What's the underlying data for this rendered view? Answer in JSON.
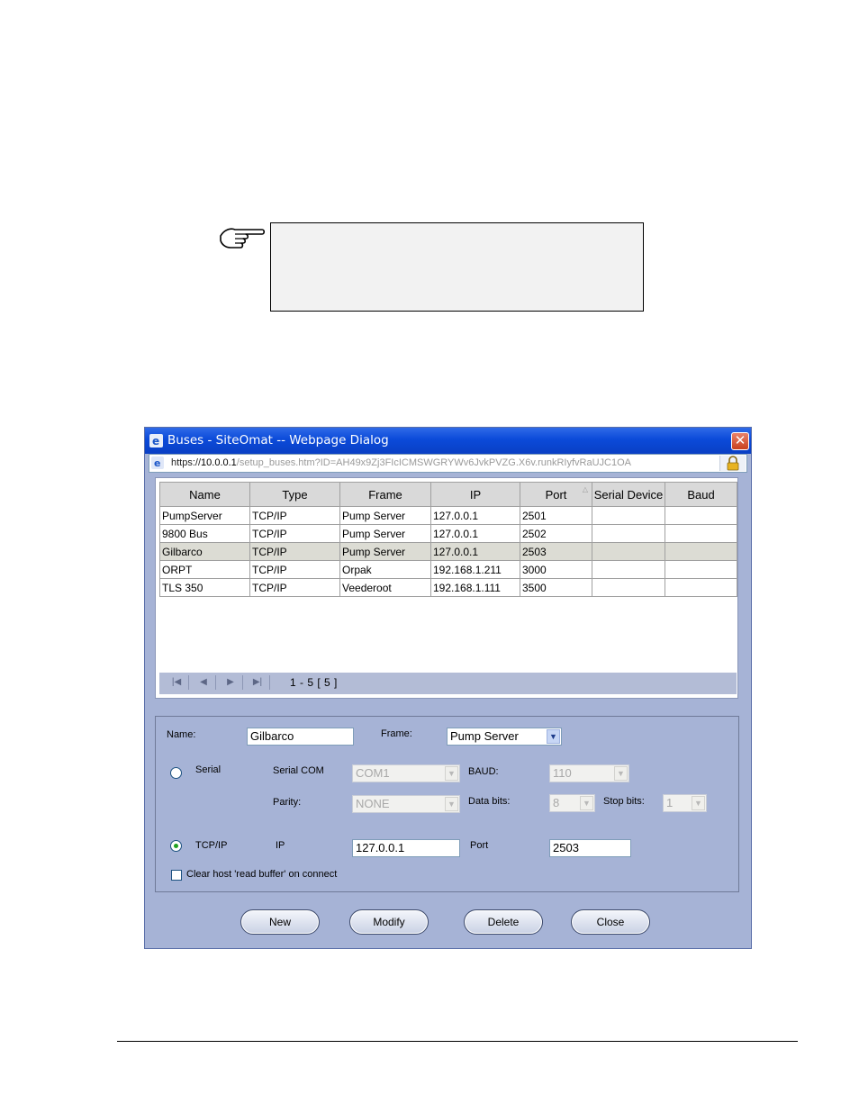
{
  "dialog": {
    "title": "Buses - SiteOmat -- Webpage Dialog",
    "url_scheme": "https://",
    "url_host": "10.0.0.1",
    "url_path": "/setup_buses.htm?ID=AH49x9Zj3FIcICMSWGRYWv6JvkPVZG.X6v.runkRIyfvRaUJC1OA",
    "close_glyph": "✕"
  },
  "grid": {
    "columns": [
      "Name",
      "Type",
      "Frame",
      "IP",
      "Port",
      "Serial Device",
      "Baud"
    ],
    "rows": [
      [
        "PumpServer",
        "TCP/IP",
        "Pump Server",
        "127.0.0.1",
        "2501",
        "",
        ""
      ],
      [
        "9800 Bus",
        "TCP/IP",
        "Pump Server",
        "127.0.0.1",
        "2502",
        "",
        ""
      ],
      [
        "Gilbarco",
        "TCP/IP",
        "Pump Server",
        "127.0.0.1",
        "2503",
        "",
        ""
      ],
      [
        "ORPT",
        "TCP/IP",
        "Orpak",
        "192.168.1.211",
        "3000",
        "",
        ""
      ],
      [
        "TLS 350",
        "TCP/IP",
        "Veederoot",
        "192.168.1.111",
        "3500",
        "",
        ""
      ]
    ],
    "selected_row": 2,
    "sort_indicator": "△",
    "pager_info": "1 - 5  [ 5 ]",
    "pager_buttons": [
      "|◀",
      "◀",
      "▶",
      "▶|"
    ]
  },
  "form": {
    "name_label": "Name:",
    "name_value": "Gilbarco",
    "frame_label": "Frame:",
    "frame_value": "Pump Server",
    "serial_label": "Serial",
    "serial_com_label": "Serial COM",
    "serial_com_value": "COM1",
    "baud_label": "BAUD:",
    "baud_value": "110",
    "parity_label": "Parity:",
    "parity_value": "NONE",
    "data_bits_label": "Data bits:",
    "data_bits_value": "8",
    "stop_bits_label": "Stop bits:",
    "stop_bits_value": "1",
    "tcpip_label": "TCP/IP",
    "ip_label": "IP",
    "ip_value": "127.0.0.1",
    "port_label": "Port",
    "port_value": "2503",
    "clear_buffer_label": "Clear host 'read buffer' on connect",
    "selected_connection": "TCP/IP",
    "clear_buffer_checked": false
  },
  "buttons": {
    "new": "New",
    "modify": "Modify",
    "delete": "Delete",
    "close": "Close"
  },
  "icons": {
    "note": "pointing-hand-icon",
    "browser": "ie-icon",
    "lock": "lock-icon"
  },
  "colors": {
    "dialog_bg": "#a6b3d6",
    "titlebar": "#0b4ad9",
    "selected_row": "#dcdcd4"
  }
}
